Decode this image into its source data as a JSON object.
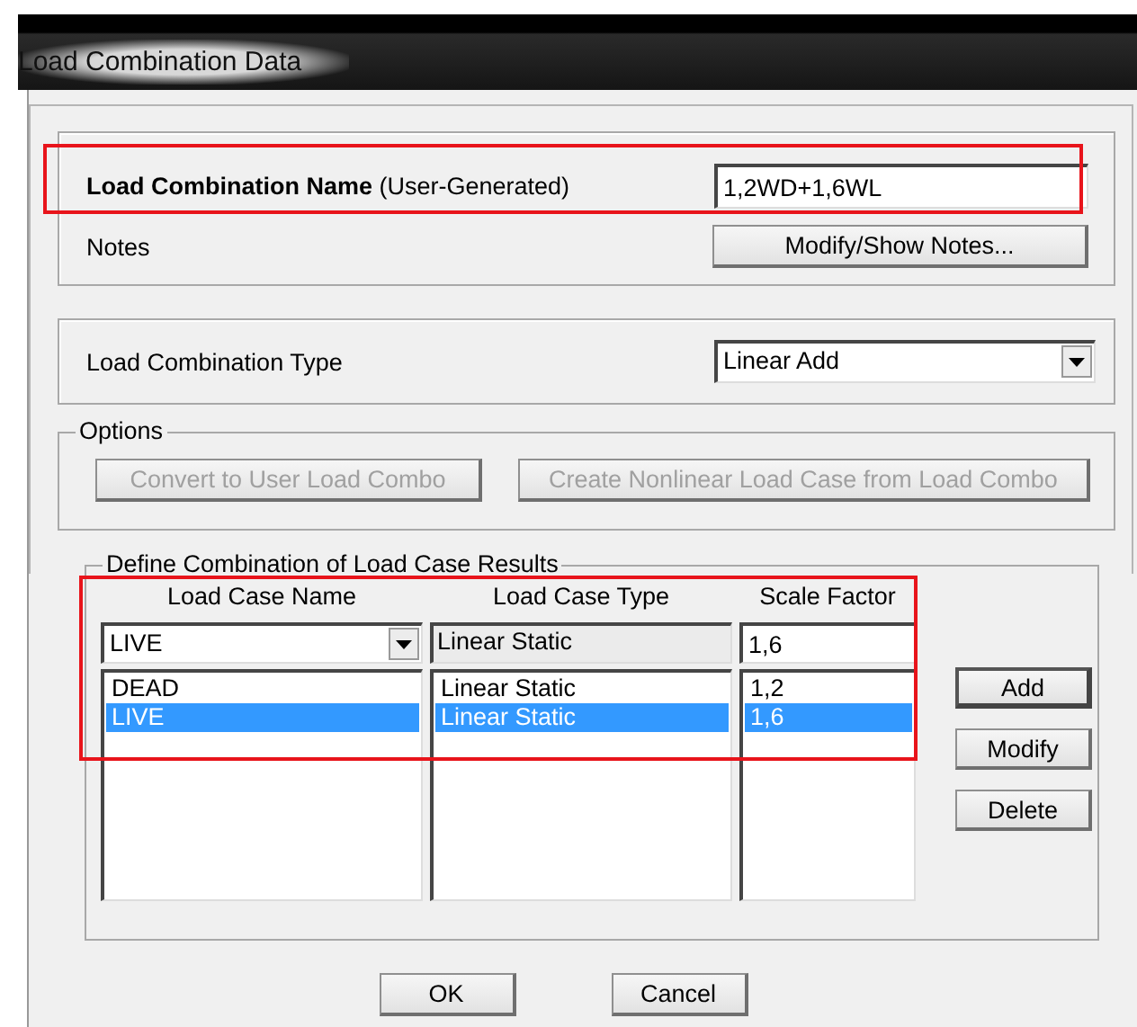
{
  "window": {
    "title": "Load Combination Data"
  },
  "name_section": {
    "label": "**Load Combination Name** (User-Generated)",
    "value": "1,2WD+1,6WL",
    "notes_label": "Notes",
    "notes_button": "Modify/Show Notes..."
  },
  "type_section": {
    "label": "Load Combination Type",
    "value": "Linear Add"
  },
  "options": {
    "title": "Options",
    "buttons": [
      {
        "label": "Convert to User Load Combo",
        "disabled": true
      },
      {
        "label": "Create Nonlinear Load Case from Load Combo",
        "disabled": true
      }
    ]
  },
  "combination": {
    "title": "Define Combination of Load Case Results",
    "columns": [
      "Load Case Name",
      "Load Case Type",
      "Scale Factor"
    ],
    "editor": {
      "case": "LIVE",
      "type": "Linear Static",
      "factor": "1,6"
    },
    "rows": [
      {
        "case": "DEAD",
        "type": "Linear Static",
        "factor": "1,2",
        "selected": false
      },
      {
        "case": "LIVE",
        "type": "Linear Static",
        "factor": "1,6",
        "selected": true
      }
    ],
    "buttons": [
      "Add",
      "Modify",
      "Delete"
    ]
  },
  "footer_buttons": [
    "OK",
    "Cancel"
  ]
}
